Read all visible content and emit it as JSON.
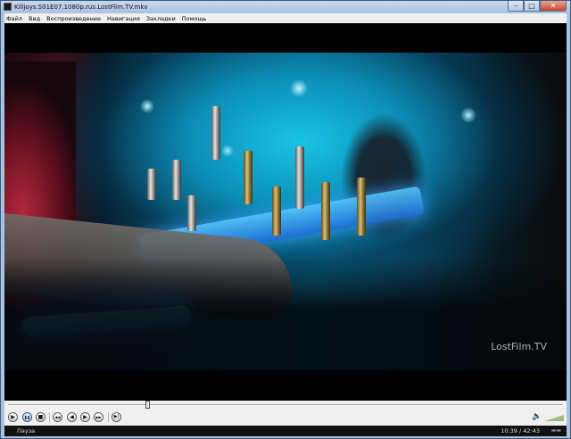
{
  "window": {
    "title": "Killjoys.S01E07.1080p.rus.LostFilm.TV.mkv",
    "minimize": "–",
    "maximize": "□",
    "close": "✕"
  },
  "menu": {
    "items": [
      {
        "label": "Файл"
      },
      {
        "label": "Вид"
      },
      {
        "label": "Воспроизведение"
      },
      {
        "label": "Навигация"
      },
      {
        "label": "Закладки"
      },
      {
        "label": "Помощь"
      }
    ]
  },
  "video": {
    "watermark": "LostFilm.TV"
  },
  "seek": {
    "position_fraction": 0.25
  },
  "controls": {
    "play": "▶",
    "pause": "❚❚",
    "stop": "■",
    "prev": "◀◀",
    "frame_back": "◀",
    "frame_forward": "▶",
    "next": "▶▶",
    "frame_step": "▶|",
    "speaker_icon": "🔈",
    "volume_fraction": 1.0
  },
  "status": {
    "state": "Пауза",
    "time": "10:39 / 42:43",
    "icon_text": "▬▬"
  }
}
